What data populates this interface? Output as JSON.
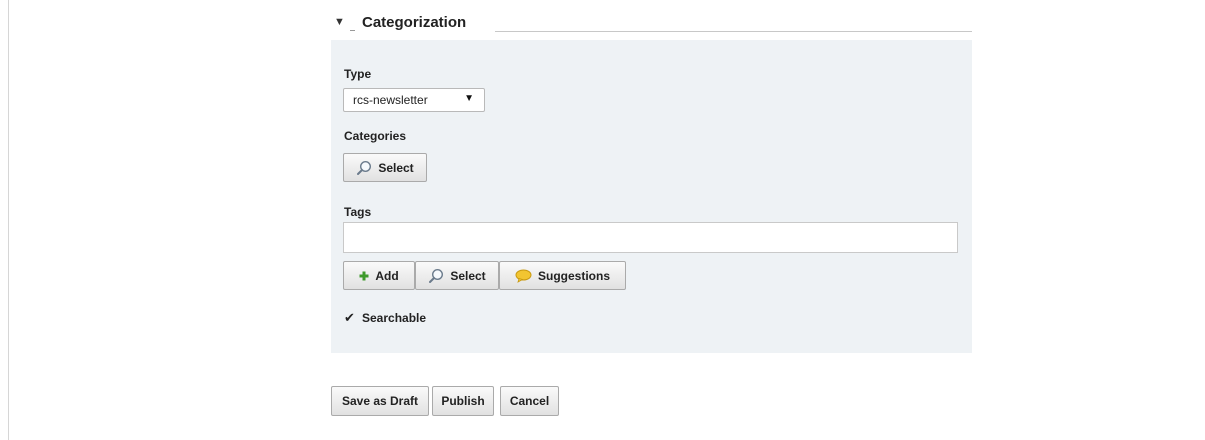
{
  "section": {
    "toggle_icon": "triangle-down-icon",
    "title": "Categorization"
  },
  "type_field": {
    "label": "Type",
    "value": "rcs-newsletter",
    "caret_icon": "triangle-down-icon"
  },
  "categories_field": {
    "label": "Categories",
    "select_label": "Select",
    "select_icon": "magnifier-icon"
  },
  "tags_field": {
    "label": "Tags",
    "value": "",
    "add_label": "Add",
    "add_icon": "plus-icon",
    "select_label": "Select",
    "select_icon": "magnifier-icon",
    "suggestions_label": "Suggestions",
    "suggestions_icon": "speech-bubble-icon"
  },
  "searchable": {
    "label": "Searchable",
    "checked": true
  },
  "actions": {
    "save_draft": "Save as Draft",
    "publish": "Publish",
    "cancel": "Cancel"
  },
  "colors": {
    "panel_bg": "#eef2f5",
    "add_icon_green": "#3e9a2b",
    "suggestion_icon_yellow": "#f2c531"
  }
}
